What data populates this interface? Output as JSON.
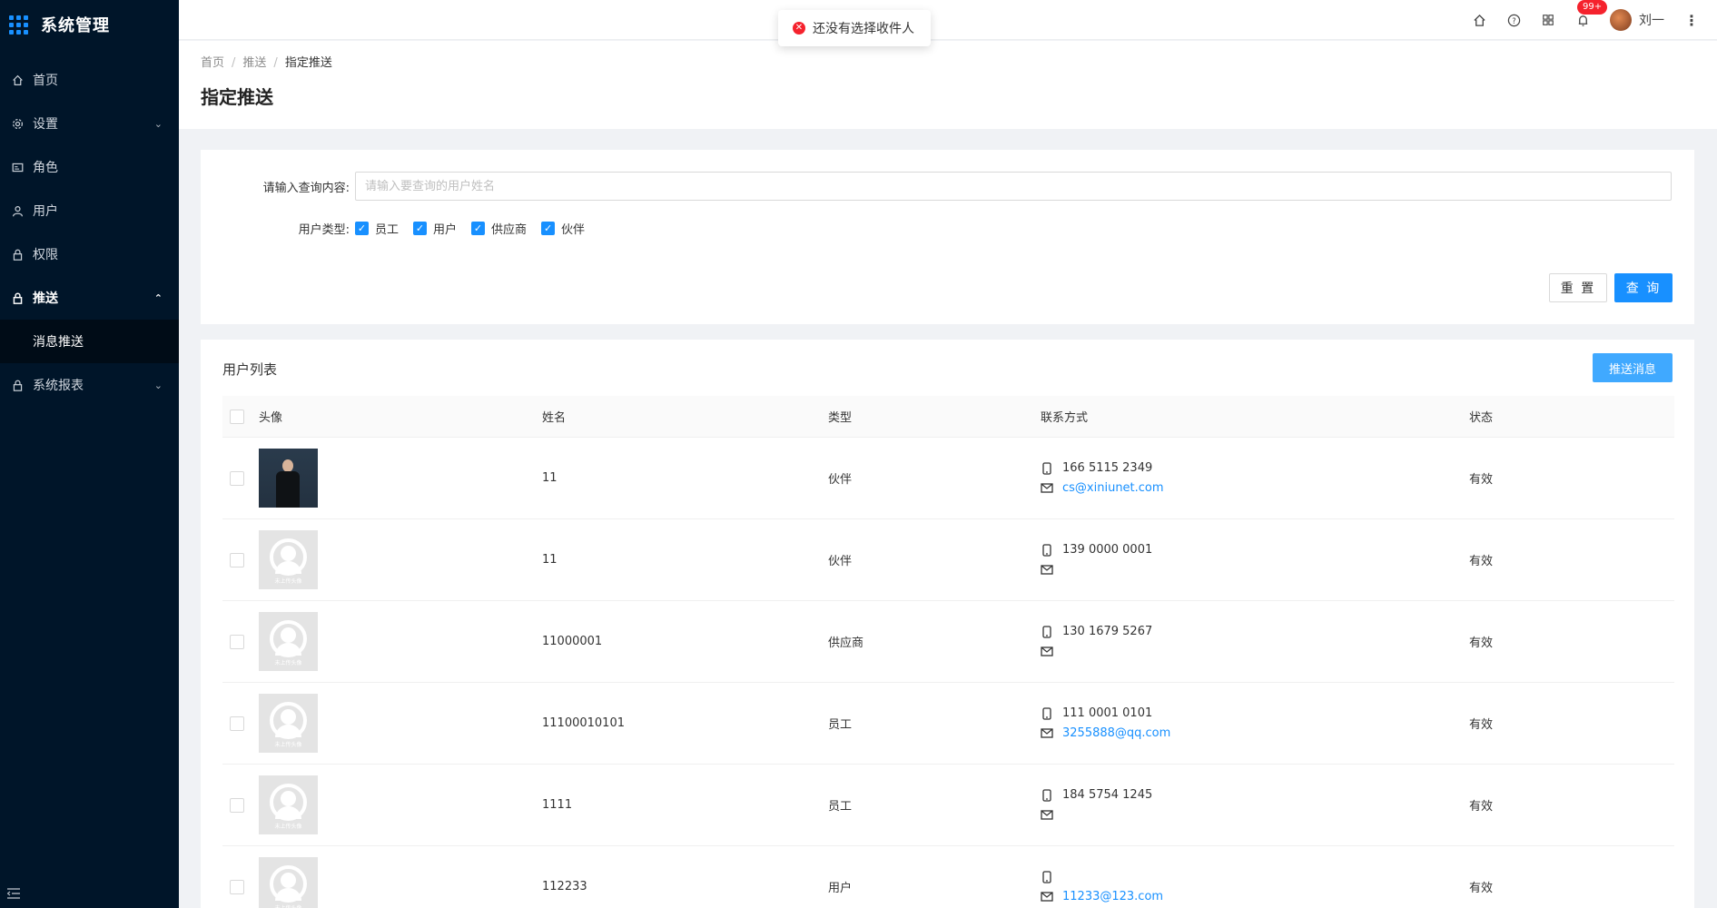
{
  "app": {
    "title": "系统管理"
  },
  "sidebar": {
    "items": [
      {
        "label": "首页",
        "icon": "home-icon"
      },
      {
        "label": "设置",
        "icon": "gear-icon"
      },
      {
        "label": "角色",
        "icon": "id-card-icon"
      },
      {
        "label": "用户",
        "icon": "user-icon"
      },
      {
        "label": "权限",
        "icon": "lock-icon"
      },
      {
        "label": "推送",
        "icon": "lock-icon"
      },
      {
        "label": "消息推送"
      },
      {
        "label": "系统报表",
        "icon": "lock-icon"
      }
    ]
  },
  "header": {
    "notification_badge": "99+",
    "user_name": "刘一"
  },
  "toast": {
    "message": "还没有选择收件人",
    "type": "error"
  },
  "breadcrumb": {
    "home": "首页",
    "parent": "推送",
    "current": "指定推送"
  },
  "page": {
    "title": "指定推送"
  },
  "search": {
    "label": "请输入查询内容:",
    "placeholder": "请输入要查询的用户姓名",
    "value": "",
    "type_label": "用户类型:",
    "types": [
      {
        "label": "员工",
        "checked": true
      },
      {
        "label": "用户",
        "checked": true
      },
      {
        "label": "供应商",
        "checked": true
      },
      {
        "label": "伙伴",
        "checked": true
      }
    ],
    "reset_label": "重 置",
    "query_label": "查 询"
  },
  "table": {
    "title": "用户列表",
    "push_button": "推送消息",
    "columns": [
      "头像",
      "姓名",
      "类型",
      "联系方式",
      "状态"
    ],
    "default_avatar_text": "未上传头像",
    "rows": [
      {
        "avatar": "photo",
        "name": "11",
        "type": "伙伴",
        "phone": "166 5115 2349",
        "email": "cs@xiniunet.com",
        "status": "有效"
      },
      {
        "avatar": "default",
        "name": "11",
        "type": "伙伴",
        "phone": "139 0000 0001",
        "email": "",
        "status": "有效"
      },
      {
        "avatar": "default",
        "name": "11000001",
        "type": "供应商",
        "phone": "130 1679 5267",
        "email": "",
        "status": "有效"
      },
      {
        "avatar": "default",
        "name": "11100010101",
        "type": "员工",
        "phone": "111 0001 0101",
        "email": "3255888@qq.com",
        "status": "有效"
      },
      {
        "avatar": "default",
        "name": "1111",
        "type": "员工",
        "phone": "184 5754 1245",
        "email": "",
        "status": "有效"
      },
      {
        "avatar": "default",
        "name": "112233",
        "type": "用户",
        "phone": "",
        "email": "11233@123.com",
        "status": "有效"
      }
    ]
  },
  "colors": {
    "sidebar_bg": "#001529",
    "primary": "#1890ff",
    "error": "#f5222d"
  }
}
